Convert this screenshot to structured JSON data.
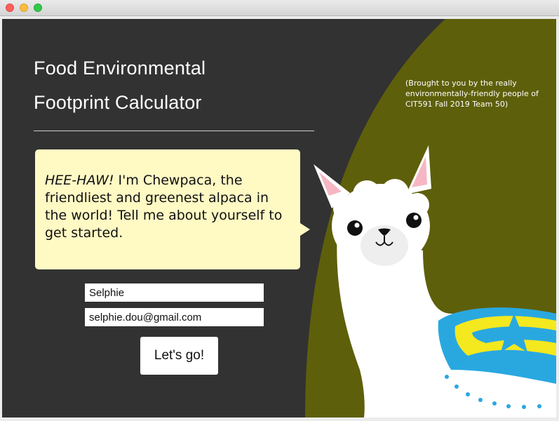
{
  "window": {
    "controls": [
      "close-button",
      "minimize-button",
      "zoom-button"
    ]
  },
  "app": {
    "title_line1": "Food Environmental",
    "title_line2": "Footprint Calculator",
    "credit": "(Brought to you by the really environmentally-friendly people of CIT591 Fall 2019 Team 50)"
  },
  "speech": {
    "exclaim": "HEE-HAW!",
    "text": " I'm Chewpaca, the friendliest and greenest alpaca in the world! Tell me about yourself to get started."
  },
  "form": {
    "name_value": "Selphie",
    "email_value": "selphie.dou@gmail.com",
    "submit_label": "Let's go!"
  },
  "mascot": {
    "name": "alpaca-illustration"
  },
  "colors": {
    "background": "#323232",
    "accent_olive": "#5e5f0a",
    "bubble": "#fff9c4",
    "blanket_blue": "#29a8e0",
    "blanket_yellow": "#f4e81f"
  }
}
